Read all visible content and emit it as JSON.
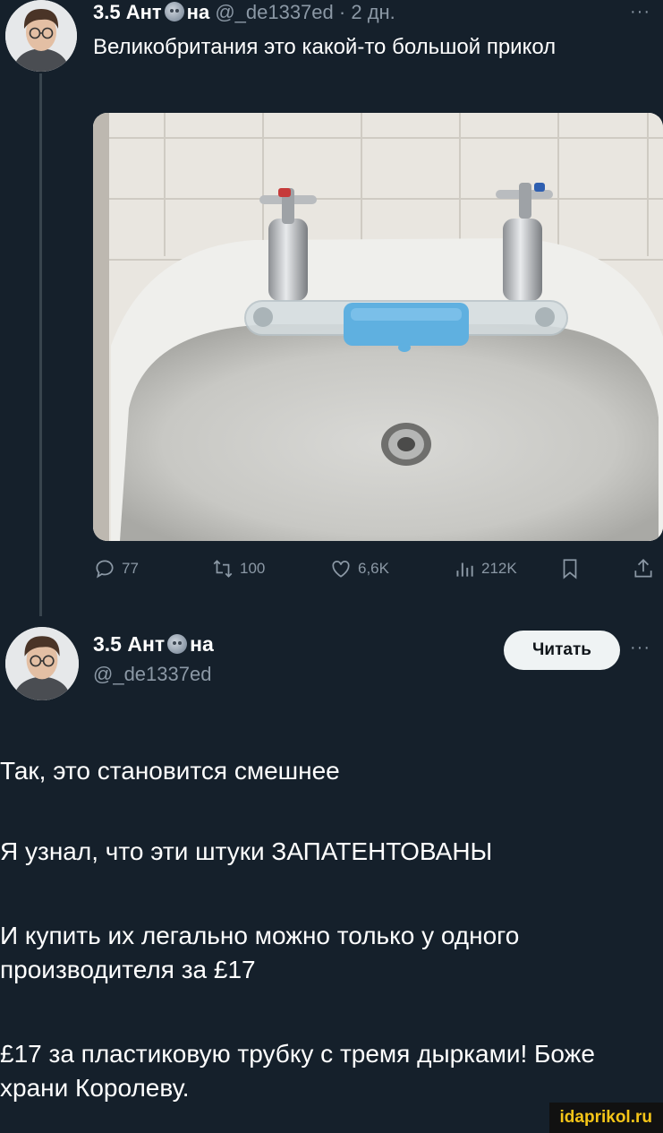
{
  "post1": {
    "author_name": "3.5 Ант",
    "author_suffix": "на",
    "handle": "@_de1337ed",
    "separator": "·",
    "age": "2 дн.",
    "more": "···",
    "text": "Великобритания это какой-то большой прикол",
    "stats": {
      "replies": "77",
      "reposts": "100",
      "likes": "6,6K",
      "views": "212K"
    }
  },
  "post2": {
    "author_name": "3.5 Ант",
    "author_suffix": "на",
    "handle": "@_de1337ed",
    "follow_label": "Читать",
    "more": "···",
    "paragraphs": [
      "Так, это становится смешнее",
      "Я узнал, что эти штуки ЗАПАТЕНТОВАНЫ",
      "И купить их легально можно только у одного производителя за £17",
      "£17 за пластиковую трубку с тремя дырками! Боже храни Королеву."
    ]
  },
  "watermark": "idaprikol.ru",
  "colors": {
    "background": "#15202b",
    "muted": "#8b98a5",
    "soap_blue": "#5fb0e0"
  }
}
